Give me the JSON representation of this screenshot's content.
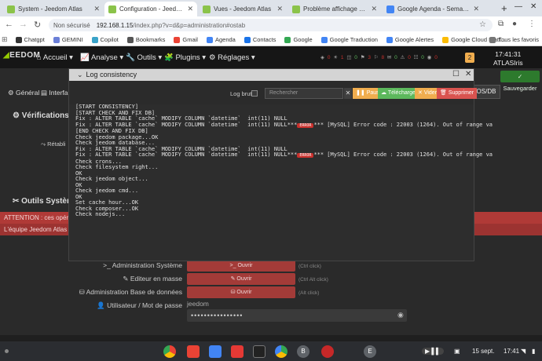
{
  "browser": {
    "tabs": [
      {
        "title": "System - Jeedom Atlas",
        "fav": "#8bc34a",
        "active": false
      },
      {
        "title": "Configuration - Jeedom Atlas",
        "fav": "#8bc34a",
        "active": true
      },
      {
        "title": "Vues - Jeedom Atlas",
        "fav": "#8bc34a",
        "active": false
      },
      {
        "title": "Problème affichage suivi con",
        "fav": "#8bc34a",
        "active": false
      },
      {
        "title": "Google Agenda - Semaine d",
        "fav": "#4285f4",
        "active": false
      }
    ],
    "security_label": "Non sécurisé",
    "url_host": "192.168.1.15",
    "url_path": "/index.php?v=d&p=administration#ostab",
    "bookmarks": [
      "Chatgpt",
      "GEMINI",
      "Copilot",
      "Bookmarks",
      "Gmail",
      "Agenda",
      "Contacts",
      "Google",
      "Google Traduction",
      "Google Alertes",
      "Google Cloud Platf..."
    ],
    "all_bookmarks": "Tous les favoris"
  },
  "jeedom": {
    "menu": [
      "Accueil",
      "Analyse",
      "Outils",
      "Plugins",
      "Réglages"
    ],
    "notif_count": "2",
    "time": "17:41:31",
    "user": "ATLASIris",
    "save_label": "Sauvegarder",
    "tabs": [
      "Général",
      "Interfa"
    ],
    "osdb_tab": "OS/DB",
    "verif_title": "Vérifications S",
    "retab_label": "Rétabli",
    "outils_title": "Outils Système",
    "warn1": "ATTENTION : ces opérati",
    "warn2": "L'équipe Jeedom Atlas se",
    "rows": [
      {
        "label": "Administration Système",
        "button": "Ouvrir",
        "hint": "(Ctrl click)"
      },
      {
        "label": "Editeur en masse",
        "button": "Ouvrir",
        "hint": "(Ctrl Alt click)"
      },
      {
        "label": "Administration Base de données",
        "button": "Ouvrir",
        "hint": "(Alt click)"
      }
    ],
    "user_label": "Utilisateur / Mot de passe",
    "user_value": "jeedom",
    "password_mask": "••••••••••••••••"
  },
  "modal": {
    "title": "Log consistency",
    "log_brut": "Log brut",
    "search_placeholder": "Rechercher",
    "buttons": {
      "pause": "Pause",
      "download": "Télécharger",
      "clear": "Vider",
      "delete": "Supprimer"
    },
    "log_lines": [
      "[START CONSISTENCY]",
      "[START CHECK AND FIX DB]",
      "Fix : ALTER TABLE `cache` MODIFY COLUMN `datetime`  int(11) NULL",
      "Fix : ALTER TABLE `cache` MODIFY COLUMN `datetime`  int(11) NULL***",
      "[END CHECK AND FIX DB]",
      "Check jeedom package...OK",
      "Check jeedom database...",
      "Fix : ALTER TABLE `cache` MODIFY COLUMN `datetime`  int(11) NULL",
      "Fix : ALTER TABLE `cache` MODIFY COLUMN `datetime`  int(11) NULL***",
      "Check crons...",
      "Check filesystem right...",
      "OK",
      "Check jeedom object...",
      "OK",
      "Check jeedom cmd...",
      "OK",
      "Set cache hour...OK",
      "Check composer...OK",
      "Check nodejs..."
    ],
    "error_tag": "ERROR",
    "error_tail": "*** [MySQL] Error code : 22003 (1264). Out of range va"
  },
  "taskbar": {
    "date": "15 sept.",
    "time": "17:41",
    "battery_label": "B",
    "e_label": "E"
  }
}
